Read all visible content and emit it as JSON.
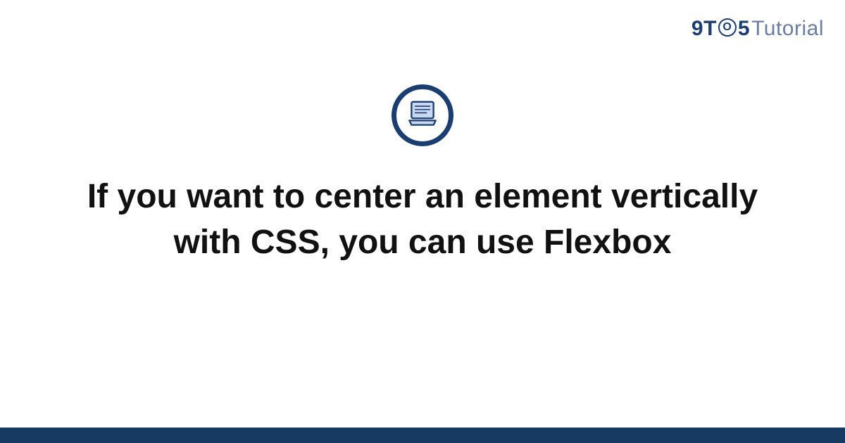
{
  "brand": {
    "part1": "9",
    "letterT": "T",
    "circleLetter": "O",
    "part3": "5",
    "part4": "Tutorial"
  },
  "hero": {
    "icon": "laptop-icon",
    "title": "If you want to center an element vertically with CSS, you can use Flexbox"
  },
  "colors": {
    "brandDark": "#1a3e72",
    "footer": "#173a63",
    "iconFill": "#c9d8f0"
  }
}
